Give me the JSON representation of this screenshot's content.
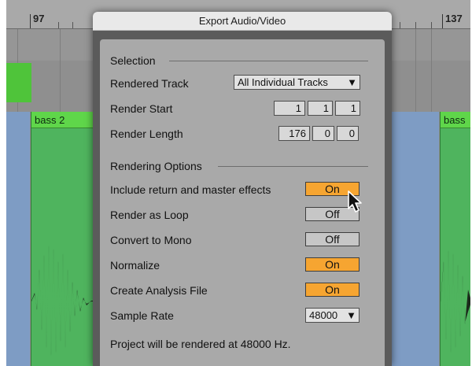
{
  "ruler": {
    "marker_left": "97",
    "marker_right": "137"
  },
  "tracks": {
    "clip_left_name": "bass 2",
    "clip_right_name": "bass"
  },
  "dialog": {
    "title": "Export Audio/Video",
    "selection": {
      "header": "Selection",
      "rendered_track_label": "Rendered Track",
      "rendered_track_value": "All Individual Tracks",
      "render_start_label": "Render Start",
      "render_start": [
        "1",
        "1",
        "1"
      ],
      "render_length_label": "Render Length",
      "render_length": [
        "176",
        "0",
        "0"
      ]
    },
    "options": {
      "header": "Rendering Options",
      "items": [
        {
          "label": "Include return and master effects",
          "value": "On"
        },
        {
          "label": "Render as Loop",
          "value": "Off"
        },
        {
          "label": "Convert to Mono",
          "value": "Off"
        },
        {
          "label": "Normalize",
          "value": "On"
        },
        {
          "label": "Create Analysis File",
          "value": "On"
        }
      ],
      "sample_rate_label": "Sample Rate",
      "sample_rate_value": "48000",
      "note": "Project will be rendered at 48000 Hz."
    }
  },
  "colors": {
    "toggle_on": "#f6a531",
    "toggle_off": "#c6c6c6",
    "clip_green": "#4fb45e"
  },
  "icons": {
    "dropdown_arrow": "triangle-down-icon",
    "cursor": "pointer-cursor-icon"
  }
}
